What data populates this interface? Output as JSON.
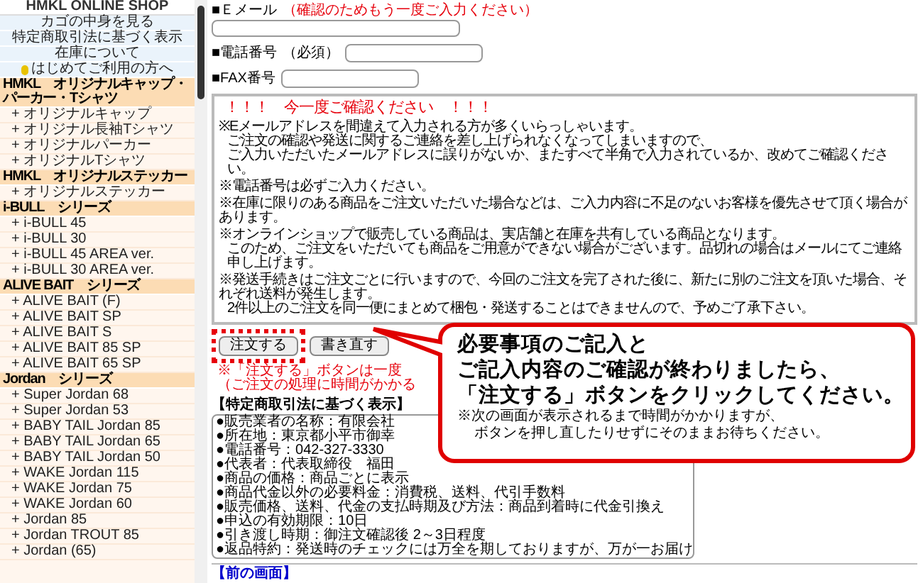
{
  "sidebar": {
    "title": "HMKL ONLINE SHOP",
    "links": [
      {
        "label": "カゴの中身を見る",
        "icon": false
      },
      {
        "label": "特定商取引法に基づく表示",
        "icon": false
      },
      {
        "label": "在庫について",
        "icon": false
      },
      {
        "label": "はじめてご利用の方へ",
        "icon": true
      }
    ],
    "categories": [
      {
        "title": "HMKL　オリジナルキャップ・パーカー・Tシャツ",
        "items": [
          "+ オリジナルキャップ",
          "+ オリジナル長袖Tシャツ",
          "+ オリジナルパーカー",
          "+ オリジナルTシャツ"
        ]
      },
      {
        "title": "HMKL　オリジナルステッカー",
        "items": [
          "+ オリジナルステッカー"
        ]
      },
      {
        "title": "i-BULL　シリーズ",
        "items": [
          "+ i-BULL 45",
          "+ i-BULL 30",
          "+ i-BULL 45 AREA ver.",
          "+ i-BULL 30 AREA ver."
        ]
      },
      {
        "title": "ALIVE BAIT　シリーズ",
        "items": [
          "+ ALIVE BAIT (F)",
          "+ ALIVE BAIT SP",
          "+ ALIVE BAIT S",
          "+ ALIVE BAIT 85 SP",
          "+ ALIVE BAIT 65 SP"
        ]
      },
      {
        "title": "Jordan　シリーズ",
        "items": [
          "+ Super Jordan 68",
          "+ Super Jordan 53",
          "+ BABY TAIL Jordan 85",
          "+ BABY TAIL Jordan 65",
          "+ BABY TAIL Jordan 50",
          "+ WAKE Jordan 115",
          "+ WAKE Jordan 75",
          "+ WAKE Jordan 60",
          "+ Jordan 85",
          "+ Jordan TROUT 85",
          "+ Jordan (65)"
        ]
      }
    ]
  },
  "form": {
    "email": {
      "label": "■Ｅメール",
      "hint": "（確認のためもう一度ご入力ください）"
    },
    "phone": {
      "label": "■電話番号",
      "hint": "（必須）"
    },
    "fax": {
      "label": "■FAX番号"
    }
  },
  "notice": {
    "title": "！！！　今一度ご確認ください　！！！",
    "paragraphs": [
      [
        "※Eメールアドレスを間違えて入力される方が多くいらっしゃいます。",
        "ご注文の確認や発送に関するご連絡を差し上げられなくなってしまいますので、",
        "ご入力いただいたメールアドレスに誤りがないか、またすべて半角で入力されているか、改めてご確認ください。"
      ],
      [
        "※電話番号は必ずご入力ください。"
      ],
      [
        "※在庫に限りのある商品をご注文いただいた場合などは、ご入力内容に不足のないお客様を優先させて頂く場合があります。"
      ],
      [
        "※オンラインショップで販売している商品は、実店舗と在庫を共有している商品となります。",
        "このため、ご注文をいただいても商品をご用意ができない場合がございます。品切れの場合はメールにてご連絡申し上げます。"
      ],
      [
        "※発送手続きはご注文ごとに行いますので、今回のご注文を完了された後に、新たに別のご注文を頂いた場合、それぞれ送料が発生します。",
        "2件以上のご注文を同一便にまとめて梱包・発送することはできませんので、予めご了承下さい。"
      ]
    ]
  },
  "buttons": [
    {
      "label": "注文する",
      "highlighted": true
    },
    {
      "label": "書き直す",
      "highlighted": false
    }
  ],
  "notes": [
    "※「注文する」ボタンは一度",
    "（ご注文の処理に時間がかかる"
  ],
  "callout": {
    "lines": [
      "必要事項のご記入と",
      "ご記入内容のご確認が終わりましたら、",
      "「注文する」ボタンをクリックしてください。"
    ],
    "sub": [
      "※次の画面が表示されるまで時間がかかりますが、",
      "ボタンを押し直したりせずにそのままお待ちください。"
    ]
  },
  "legal": {
    "title": "【特定商取引法に基づく表示】",
    "lines": [
      "●販売業者の名称：有限会社",
      "●所在地：東京都小平市御幸",
      "●電話番号：042-327-3330",
      "●代表者：代表取締役　福田",
      "●商品の価格：商品ごとに表示",
      "●商品代金以外の必要料金：消費税、送料、代引手数料",
      "●販売価格、送料、代金の支払時期及び方法：商品到着時に代金引換え",
      "●申込の有効期限：10日",
      "●引き渡し時期：御注文確認後 2～3日程度",
      "●返品特約：発送時のチェックには万全を期しておりますが、万が一お届け"
    ]
  },
  "back_link": "【前の画面】"
}
